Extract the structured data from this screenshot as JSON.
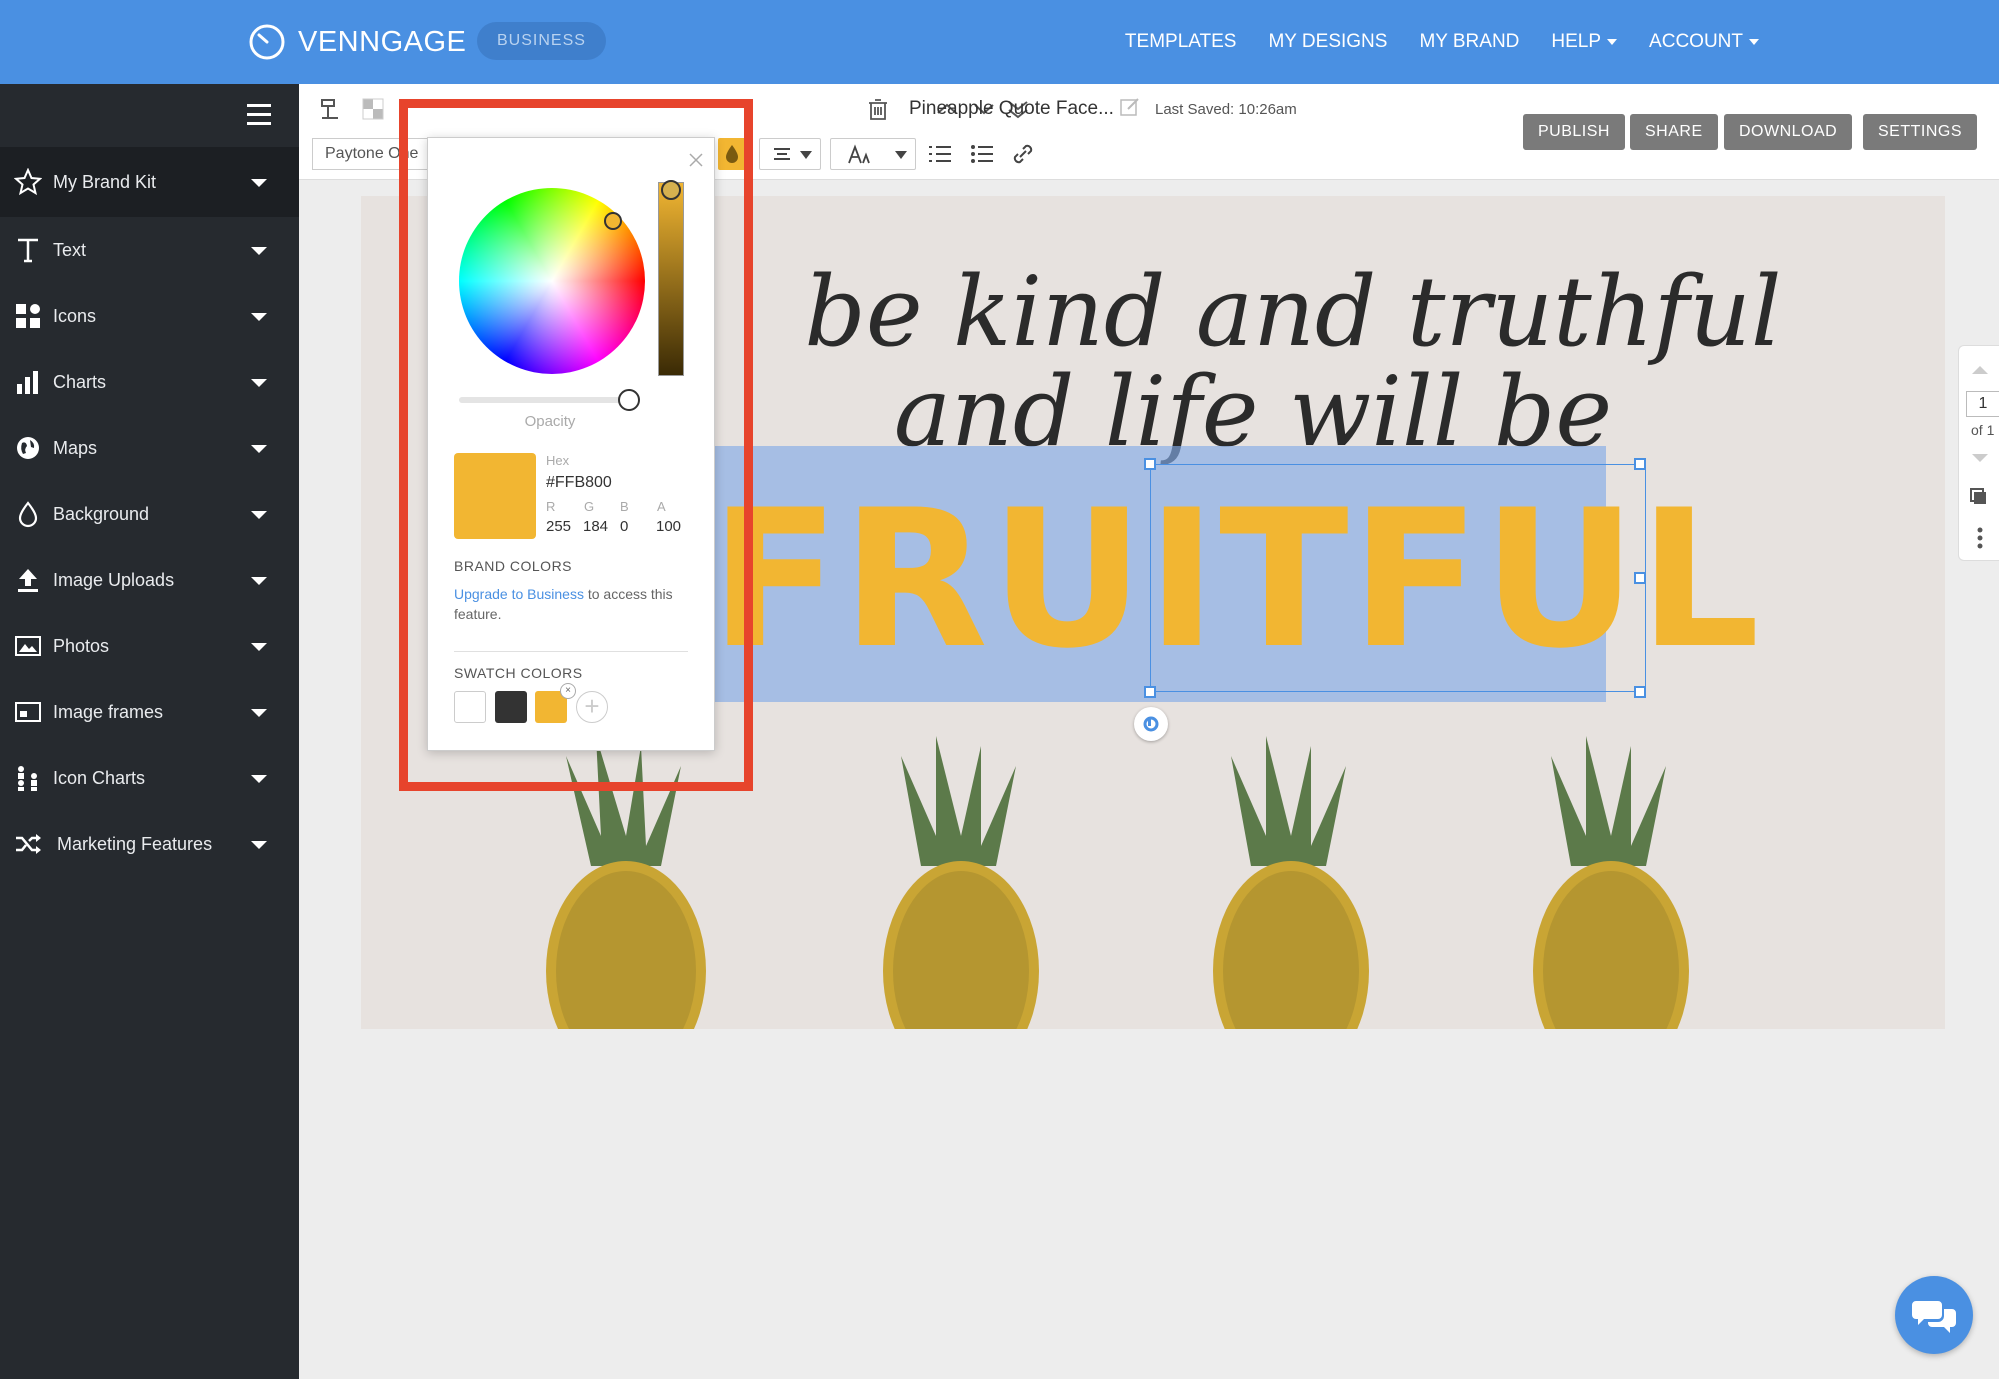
{
  "header": {
    "brand": "VENNGAGE",
    "plan_badge": "BUSINESS",
    "nav": [
      {
        "label": "TEMPLATES"
      },
      {
        "label": "MY DESIGNS"
      },
      {
        "label": "MY BRAND"
      },
      {
        "label": "HELP",
        "dropdown": true
      },
      {
        "label": "ACCOUNT",
        "dropdown": true
      }
    ]
  },
  "sidebar": {
    "items": [
      {
        "label": "My Brand Kit",
        "icon": "star-icon"
      },
      {
        "label": "Text",
        "icon": "text-icon"
      },
      {
        "label": "Icons",
        "icon": "icons-grid-icon"
      },
      {
        "label": "Charts",
        "icon": "bar-chart-icon"
      },
      {
        "label": "Maps",
        "icon": "globe-icon"
      },
      {
        "label": "Background",
        "icon": "droplet-icon"
      },
      {
        "label": "Image Uploads",
        "icon": "upload-icon"
      },
      {
        "label": "Photos",
        "icon": "photo-icon"
      },
      {
        "label": "Image frames",
        "icon": "frame-icon"
      },
      {
        "label": "Icon Charts",
        "icon": "people-chart-icon"
      },
      {
        "label": "Marketing Features",
        "icon": "shuffle-icon"
      }
    ]
  },
  "toolbar": {
    "document_title": "Pineapple Quote Face...",
    "last_saved": "Last Saved: 10:26am",
    "font_name": "Paytone One",
    "buttons": {
      "publish": "PUBLISH",
      "share": "SHARE",
      "download": "DOWNLOAD",
      "settings": "SETTINGS"
    }
  },
  "canvas": {
    "quote_line_1": "be kind and truthful",
    "quote_line_2": "and life will be",
    "headline": "FRUITFUL",
    "headline_color": "#F2B632"
  },
  "color_picker": {
    "opacity_label": "Opacity",
    "hex_label": "Hex",
    "hex_value": "#FFB800",
    "r_label": "R",
    "g_label": "G",
    "b_label": "B",
    "a_label": "A",
    "r": "255",
    "g": "184",
    "b": "0",
    "a": "100",
    "brand_colors_title": "BRAND COLORS",
    "upgrade_link": "Upgrade to Business",
    "upgrade_text": " to access this feature.",
    "swatch_title": "SWATCH COLORS",
    "swatches": [
      "#FFFFFF",
      "#333333",
      "#F2B632"
    ]
  },
  "page_nav": {
    "current": "1",
    "of_label": "of 1"
  },
  "colors": {
    "nav_blue": "#4A90E2",
    "sidebar_bg": "#262A2F",
    "highlight_red": "#E7442C",
    "accent_yellow": "#F2B632"
  }
}
